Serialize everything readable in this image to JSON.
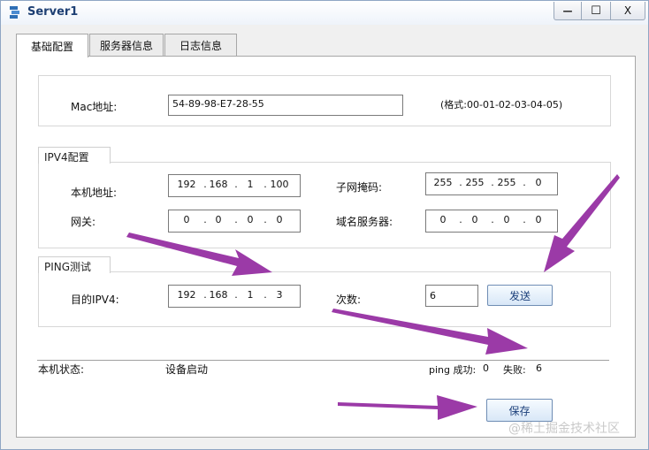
{
  "window": {
    "title": "Server1",
    "minimize_glyph": "—",
    "maximize_glyph": "☐",
    "close_glyph": "X"
  },
  "tabs": [
    {
      "label": "基础配置",
      "active": true
    },
    {
      "label": "服务器信息",
      "active": false
    },
    {
      "label": "日志信息",
      "active": false
    }
  ],
  "mac": {
    "label": "Mac地址:",
    "value": "54-89-98-E7-28-55",
    "format_hint": "(格式:00-01-02-03-04-05)"
  },
  "ipv4": {
    "section_title": "IPV4配置",
    "local_label": "本机地址:",
    "local": [
      "192",
      "168",
      "1",
      "100"
    ],
    "mask_label": "子网掩码:",
    "mask": [
      "255",
      "255",
      "255",
      "0"
    ],
    "gateway_label": "网关:",
    "gateway": [
      "0",
      "0",
      "0",
      "0"
    ],
    "dns_label": "域名服务器:",
    "dns": [
      "0",
      "0",
      "0",
      "0"
    ]
  },
  "ping": {
    "section_title": "PING测试",
    "dest_label": "目的IPV4:",
    "dest": [
      "192",
      "168",
      "1",
      "3"
    ],
    "count_label": "次数:",
    "count": "6",
    "send_label": "发送"
  },
  "status": {
    "label": "本机状态:",
    "value": "设备启动",
    "success_label": "ping 成功:",
    "success": "0",
    "fail_label": "失败:",
    "fail": "6"
  },
  "save_label": "保存",
  "watermark": "@稀土掘金技术社区",
  "colors": {
    "arrow": "#9b3aa7",
    "title": "#1d3f73",
    "button_border": "#6f8db4"
  }
}
